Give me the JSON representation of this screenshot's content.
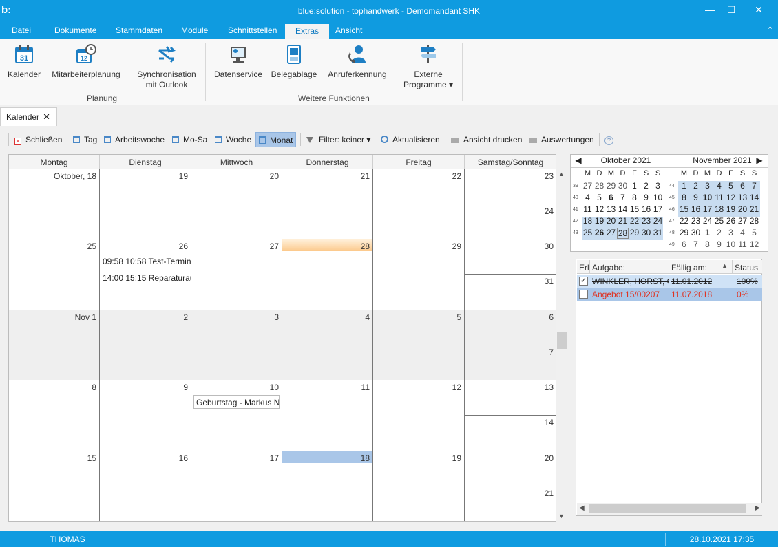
{
  "window": {
    "logo": "b:",
    "title": "blue:solution - tophandwerk - Demomandant SHK",
    "minimize": "—",
    "maximize": "☐",
    "close": "✕"
  },
  "menu": {
    "items": [
      "Datei",
      "Dokumente",
      "Stammdaten",
      "Module",
      "Schnittstellen",
      "Extras",
      "Ansicht"
    ],
    "active": "Extras",
    "collapse": "⌃"
  },
  "ribbon": {
    "kalender": "Kalender",
    "mitarbeiterplanung": "Mitarbeiterplanung",
    "sync_line1": "Synchronisation",
    "sync_line2": "mit Outlook",
    "datenservice": "Datenservice",
    "belegablage": "Belegablage",
    "anruferkennung": "Anruferkennung",
    "externe_line1": "Externe",
    "externe_line2": "Programme ▾",
    "group_planung": "Planung",
    "group_weitere": "Weitere Funktionen",
    "calendar_icon_text": "31",
    "planner_icon_text": "12"
  },
  "doctab": {
    "label": "Kalender",
    "close": "✕"
  },
  "toolbar": {
    "schliessen": "Schließen",
    "tag": "Tag",
    "arbeitswoche": "Arbeitswoche",
    "mosa": "Mo-Sa",
    "woche": "Woche",
    "monat": "Monat",
    "filter": "Filter: keiner ▾",
    "aktualisieren": "Aktualisieren",
    "drucken": "Ansicht drucken",
    "auswertungen": "Auswertungen",
    "help": "?"
  },
  "calendar": {
    "headers": [
      "Montag",
      "Dienstag",
      "Mittwoch",
      "Donnerstag",
      "Freitag",
      "Samstag/Sonntag"
    ],
    "weeks": [
      {
        "days": [
          "Oktober, 18",
          "19",
          "20",
          "21",
          "22"
        ],
        "sat": "23",
        "sun": "24"
      },
      {
        "days": [
          "25",
          "26",
          "27",
          "28",
          "29"
        ],
        "sat": "30",
        "sun": "31"
      },
      {
        "days": [
          "Nov 1",
          "2",
          "3",
          "4",
          "5"
        ],
        "sat": "6",
        "sun": "7"
      },
      {
        "days": [
          "8",
          "9",
          "10",
          "11",
          "12"
        ],
        "sat": "13",
        "sun": "14"
      },
      {
        "days": [
          "15",
          "16",
          "17",
          "18",
          "19"
        ],
        "sat": "20",
        "sun": "21"
      }
    ],
    "events": {
      "e1": "09:58 10:58 Test-Termin",
      "e2": "14:00 15:15 Reparaturau",
      "birthday": "Geburtstag - Markus N"
    }
  },
  "minical": {
    "oct_title": "Oktober 2021",
    "nov_title": "November 2021",
    "prev": "◀",
    "next": "▶",
    "dow": [
      "M",
      "D",
      "M",
      "D",
      "F",
      "S",
      "S"
    ],
    "oct_weeks": [
      "39",
      "40",
      "41",
      "42",
      "43"
    ],
    "nov_weeks": [
      "44",
      "45",
      "46",
      "47",
      "48",
      "49"
    ],
    "oct_days": [
      [
        "27",
        "28",
        "29",
        "30",
        "1",
        "2",
        "3"
      ],
      [
        "4",
        "5",
        "6",
        "7",
        "8",
        "9",
        "10"
      ],
      [
        "11",
        "12",
        "13",
        "14",
        "15",
        "16",
        "17"
      ],
      [
        "18",
        "19",
        "20",
        "21",
        "22",
        "23",
        "24"
      ],
      [
        "25",
        "26",
        "27",
        "28",
        "29",
        "30",
        "31"
      ]
    ],
    "nov_days": [
      [
        "1",
        "2",
        "3",
        "4",
        "5",
        "6",
        "7"
      ],
      [
        "8",
        "9",
        "10",
        "11",
        "12",
        "13",
        "14"
      ],
      [
        "15",
        "16",
        "17",
        "18",
        "19",
        "20",
        "21"
      ],
      [
        "22",
        "23",
        "24",
        "25",
        "26",
        "27",
        "28"
      ],
      [
        "29",
        "30",
        "1",
        "2",
        "3",
        "4",
        "5"
      ],
      [
        "6",
        "7",
        "8",
        "9",
        "10",
        "11",
        "12"
      ]
    ]
  },
  "tasks": {
    "headers": {
      "erl": "Erl",
      "aufgabe": "Aufgabe:",
      "faellig": "Fällig am:",
      "status": "Status",
      "sort": "▲"
    },
    "rows": [
      {
        "check": "✓",
        "aufgabe": "WINKLER, HORST, GE",
        "faellig": "11.01.2012",
        "status": "100%"
      },
      {
        "check": "",
        "aufgabe": "Angebot  15/00207",
        "faellig": "11.07.2018",
        "status": "0%"
      }
    ],
    "scroll_left": "◀",
    "scroll_right": "▶"
  },
  "status": {
    "user": "THOMAS",
    "datetime": "28.10.2021 17:35"
  },
  "colors": {
    "accent": "#0f9be0",
    "selected": "#a9c6e8",
    "overdue": "#e0301e"
  }
}
